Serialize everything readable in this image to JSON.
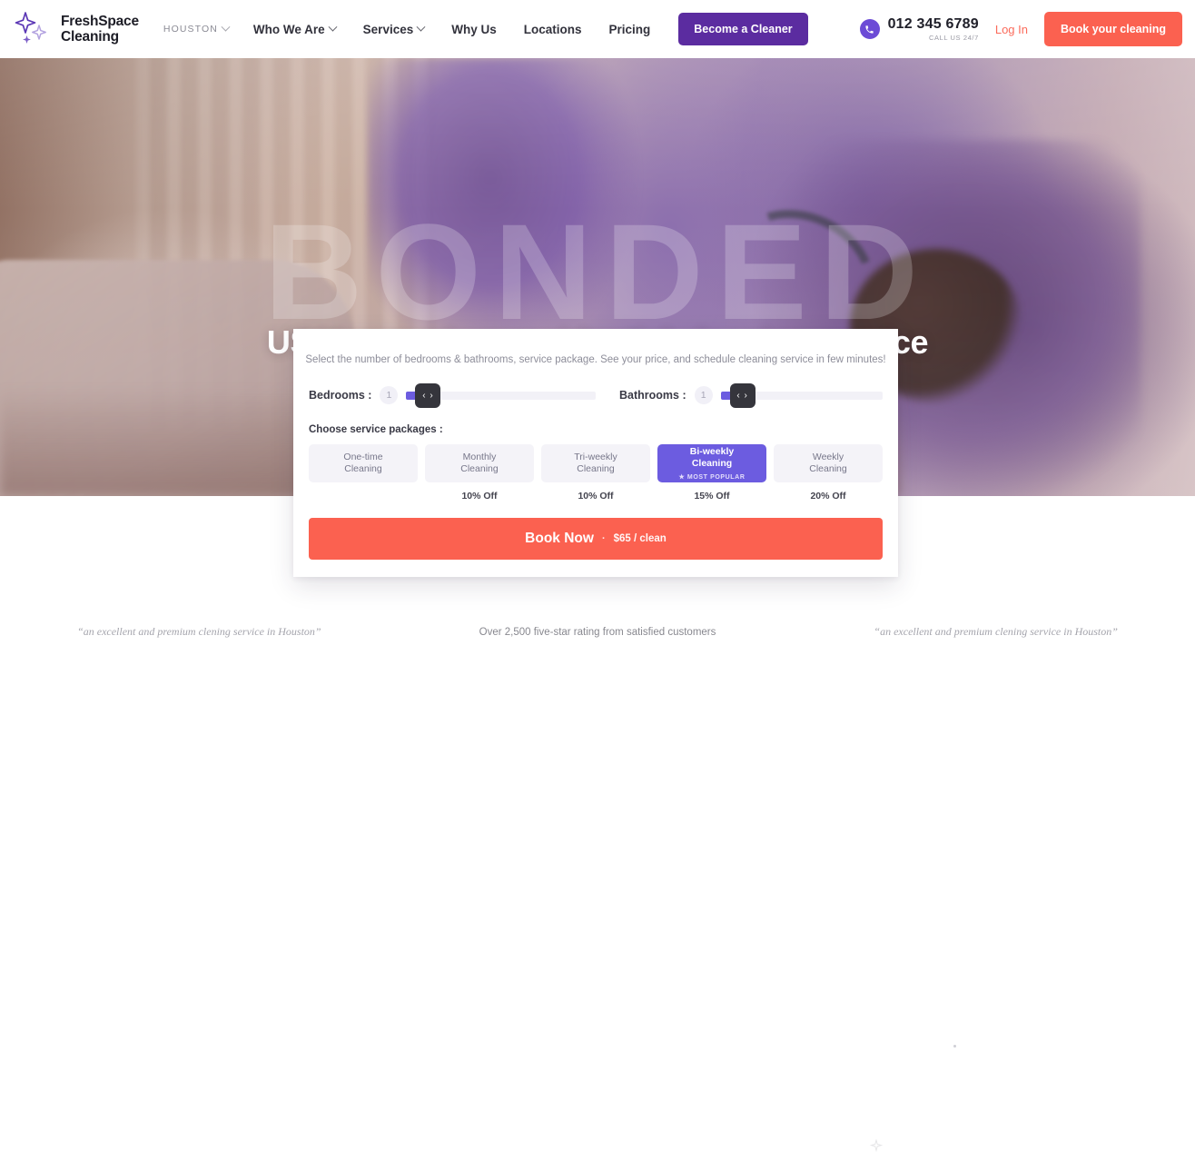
{
  "header": {
    "brand": {
      "name": "FreshSpace\nCleaning",
      "logo_icon": "sparkle-icon"
    },
    "nav": [
      {
        "label": "HOUSTON",
        "caret": true,
        "kind": "city"
      },
      {
        "label": "Who We Are",
        "caret": true
      },
      {
        "label": "Services",
        "caret": true
      },
      {
        "label": "Why Us",
        "caret": false
      },
      {
        "label": "Locations",
        "caret": false
      },
      {
        "label": "Pricing",
        "caret": false
      }
    ],
    "cleaner_button": "Become a Cleaner",
    "phone": {
      "icon": "phone-icon",
      "number": "012 345 6789",
      "sub": "CALL US 24/7"
    },
    "login": "Log In",
    "book_button": "Book your cleaning",
    "accent_purple": "#5b2ca0",
    "accent_coral": "#fb6150"
  },
  "hero": {
    "watermark": "BONDED",
    "title": "USA’s premium residential cleaning service"
  },
  "card": {
    "lead": "Select the number of bedrooms & bathrooms, service package. See your price, and schedule cleaning service in few minutes!",
    "bedrooms": {
      "label": "Bedrooms :",
      "value": "1",
      "knob": "‹ ›"
    },
    "bathrooms": {
      "label": "Bathrooms :",
      "value": "1",
      "knob": "‹ ›"
    },
    "packages_title": "Choose service packages :",
    "packages": [
      {
        "name": "One-time\nCleaning",
        "off": "",
        "selected": false,
        "badge": ""
      },
      {
        "name": "Monthly\nCleaning",
        "off": "10% Off",
        "selected": false,
        "badge": ""
      },
      {
        "name": "Tri-weekly\nCleaning",
        "off": "10% Off",
        "selected": false,
        "badge": ""
      },
      {
        "name": "Bi-weekly\nCleaning",
        "off": "15% Off",
        "selected": true,
        "badge": "★ MOST POPULAR"
      },
      {
        "name": "Weekly\nCleaning",
        "off": "20% Off",
        "selected": false,
        "badge": ""
      }
    ],
    "book_now": "Book Now",
    "book_dot": "·",
    "price": "$65 / clean"
  },
  "footer_strip": {
    "quotes": [
      "“an excellent and premium clening service in Houston”",
      "Over 2,500 five-star rating from satisfied customers",
      "“an excellent and premium clening service in Houston”"
    ]
  }
}
